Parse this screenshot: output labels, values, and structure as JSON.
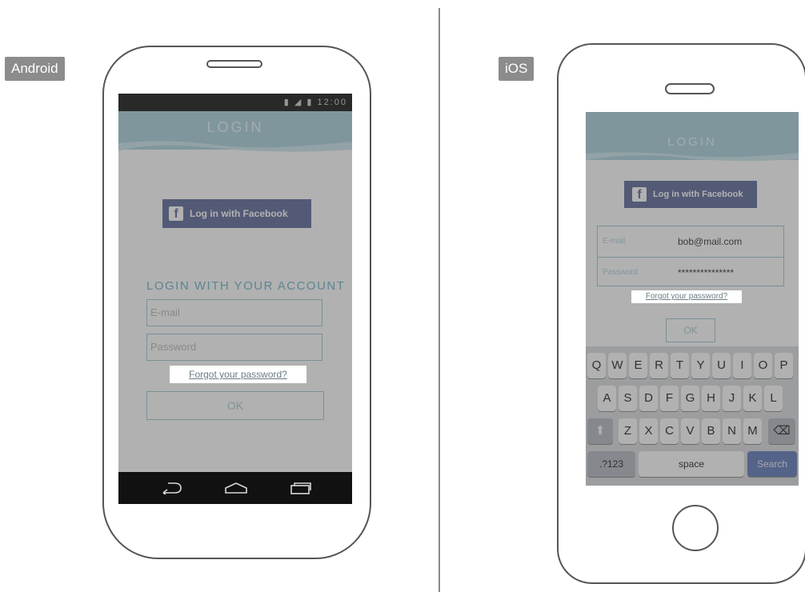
{
  "labels": {
    "android": "Android",
    "ios": "iOS"
  },
  "android": {
    "status_time": "12:00",
    "header_title": "LOGIN",
    "facebook_button": "Log in with Facebook",
    "section_title": "LOGIN WITH YOUR ACCOUNT",
    "email_placeholder": "E-mail",
    "password_placeholder": "Password",
    "forgot_link": "Forgot your password?",
    "ok_button": "OK",
    "nav_icons": [
      "back-icon",
      "home-icon",
      "recents-icon"
    ]
  },
  "ios": {
    "header_title": "LOGIN",
    "facebook_button": "Log in with Facebook",
    "email_label": "E-mail",
    "email_value": "bob@mail.com",
    "password_label": "Password",
    "password_value": "***************",
    "forgot_link": "Forgot your password?",
    "ok_button": "OK",
    "keyboard": {
      "row1": [
        "Q",
        "W",
        "E",
        "R",
        "T",
        "Y",
        "U",
        "I",
        "O",
        "P"
      ],
      "row2": [
        "A",
        "S",
        "D",
        "F",
        "G",
        "H",
        "J",
        "K",
        "L"
      ],
      "row3": [
        "Z",
        "X",
        "C",
        "V",
        "B",
        "N",
        "M"
      ],
      "numbers_key": ".?123",
      "space_key": "space",
      "search_key": "Search"
    }
  },
  "colors": {
    "accent": "#a9d1dc",
    "facebook": "#5d6a9a",
    "overlay": "#464646"
  }
}
